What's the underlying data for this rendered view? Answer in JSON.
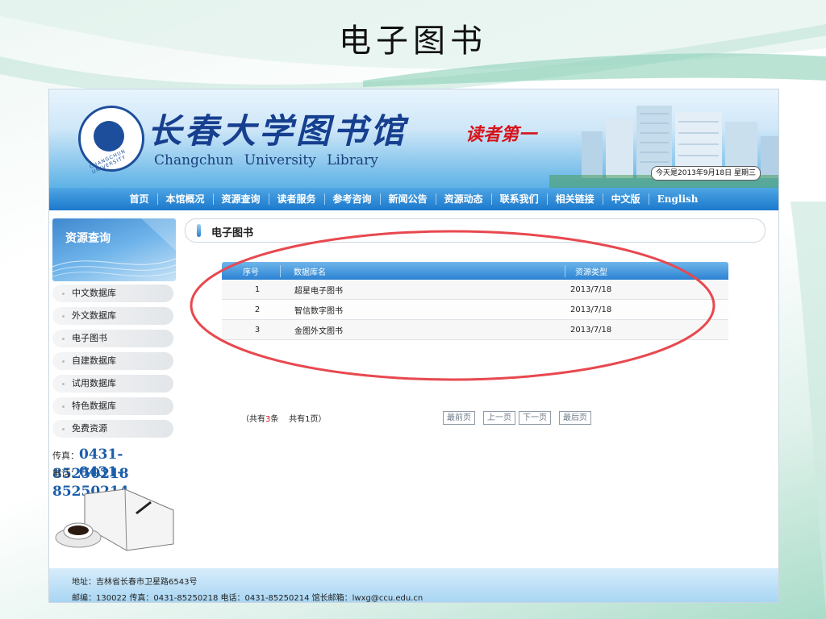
{
  "slide": {
    "title": "电子图书"
  },
  "header": {
    "library_name_cn": "长春大学图书馆",
    "library_name_en": "Changchun University Library",
    "slogan": "读者第一",
    "seal_text": "CHANGCHUN UNIVERSITY",
    "date_text": "今天是2013年9月18日 星期三"
  },
  "nav": {
    "items": [
      "首页",
      "本馆概况",
      "资源查询",
      "读者服务",
      "参考咨询",
      "新闻公告",
      "资源动态",
      "联系我们",
      "相关链接",
      "中文版",
      "English"
    ]
  },
  "sidebar": {
    "title": "资源查询",
    "items": [
      "中文数据库",
      "外文数据库",
      "电子图书",
      "自建数据库",
      "试用数据库",
      "特色数据库",
      "免费资源"
    ],
    "fax_label": "传真：",
    "fax": "0431-85250218",
    "phone_label": "电话：",
    "phone": "0431-85250214"
  },
  "content": {
    "title": "电子图书",
    "table": {
      "headers": [
        "序号",
        "数据库名",
        "资源类型"
      ],
      "rows": [
        [
          "1",
          "超星电子图书",
          "2013/7/18"
        ],
        [
          "2",
          "智信数字图书",
          "2013/7/18"
        ],
        [
          "3",
          "金图外文图书",
          "2013/7/18"
        ]
      ]
    },
    "pager": {
      "prefix": "（共有",
      "count": "3",
      "suffix": "条    共有1页）",
      "first": "最前页",
      "prev": "上一页",
      "next": "下一页",
      "last": "最后页"
    }
  },
  "footer": {
    "address": "地址：吉林省长春市卫星路6543号",
    "contact": "邮编：130022  传真：0431-85250218  电话：0431-85250214  馆长邮箱：lwxg@ccu.edu.cn"
  },
  "colors": {
    "nav_blue": "#1b78cc",
    "annotation_red": "#e8484f",
    "title_blue": "#163f8f"
  }
}
